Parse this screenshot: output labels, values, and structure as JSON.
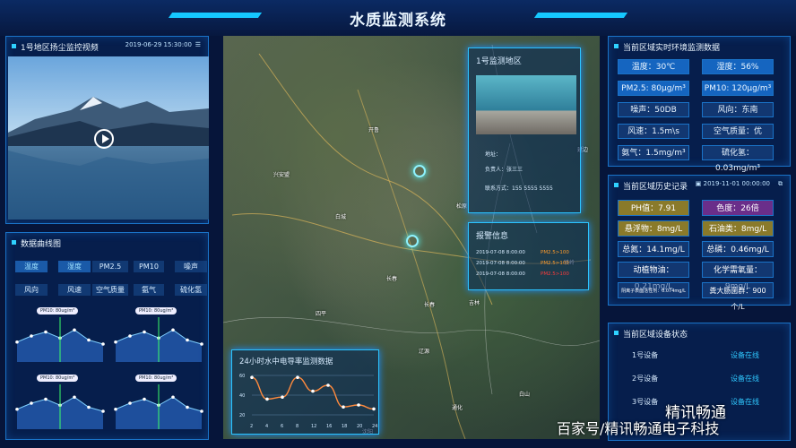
{
  "header": {
    "title": "水质监测系统"
  },
  "video": {
    "title": "1号地区扬尘监控视频",
    "datetime": "2019-06-29 15:30:00",
    "menu_icon": "list-icon",
    "play_icon": "play-icon"
  },
  "curves": {
    "title": "数据曲线图",
    "tags": [
      "温度",
      "湿度",
      "PM2.5",
      "PM10",
      "噪声",
      "风向",
      "风速",
      "空气质量",
      "氨气",
      "硫化氢"
    ],
    "chart_label": "PM10: 80ug/m³",
    "mini_series": [
      0.45,
      0.6,
      0.7,
      0.55,
      0.75,
      0.5,
      0.4
    ]
  },
  "map": {
    "labels": [
      "开鲁",
      "兴安盟",
      "白城",
      "松原",
      "四平",
      "长春",
      "吉林",
      "辽源",
      "延边",
      "通化",
      "白山",
      "铁岭",
      "沈阳",
      "长春"
    ],
    "region": {
      "title": "1号监测地区",
      "addr_label": "地址：",
      "person_label": "负责人：",
      "person": "张三三",
      "phone_label": "联系方式：",
      "phone": "155 5555 5555"
    },
    "alarm": {
      "title": "报警信息",
      "rows": [
        {
          "date": "2019-07-08",
          "time": "8:00:00",
          "msg": "PM2.5>100"
        },
        {
          "date": "2019-07-08",
          "time": "8:00:00",
          "msg": "PM2.5>100"
        },
        {
          "date": "2019-07-08",
          "time": "8:00:00",
          "msg": "PM2.5>100"
        }
      ]
    },
    "conductivity": {
      "title": "24小时水中电导率监测数据",
      "x_ticks": [
        "2",
        "4",
        "6",
        "8",
        "12",
        "16",
        "18",
        "20",
        "24"
      ],
      "y_ticks": [
        "60",
        "40",
        "20"
      ],
      "values": [
        58,
        36,
        38,
        58,
        44,
        50,
        28,
        30,
        26
      ]
    }
  },
  "env": {
    "title": "当前区域实时环境监测数据",
    "cells": [
      [
        "温度：30℃",
        "湿度：56%"
      ],
      [
        "PM2.5: 80μg/m³",
        "PM10: 120μg/m³"
      ],
      [
        "噪声：50DB",
        "风向：东南"
      ],
      [
        "风速：1.5m\\s",
        "空气质量：优"
      ],
      [
        "氨气：1.5mg/m³",
        "硫化氢：0.03mg/m³"
      ]
    ]
  },
  "history": {
    "title": "当前区域历史记录",
    "datetime": "2019-11-01 00:00:00",
    "cells": [
      [
        "PH值：7.91",
        "色度：26倍"
      ],
      [
        "悬浮物：8mg/L",
        "石油类：8mg/L"
      ],
      [
        "总氮：14.1mg/L",
        "总磷：0.46mg/L"
      ],
      [
        "动植物油：0.21mg/L",
        "化学需氧量：9mg/L"
      ],
      [
        "阴离子表面活性剂：0.074mg/L",
        "粪大肠菌群：900个/L"
      ]
    ]
  },
  "devices": {
    "title": "当前区域设备状态",
    "rows": [
      {
        "name": "1号设备",
        "status": "设备在线"
      },
      {
        "name": "2号设备",
        "status": "设备在线"
      },
      {
        "name": "3号设备",
        "status": "设备在线"
      }
    ]
  },
  "watermark": {
    "logo": "精讯畅通",
    "footer": "百家号/精讯畅通电子科技"
  }
}
